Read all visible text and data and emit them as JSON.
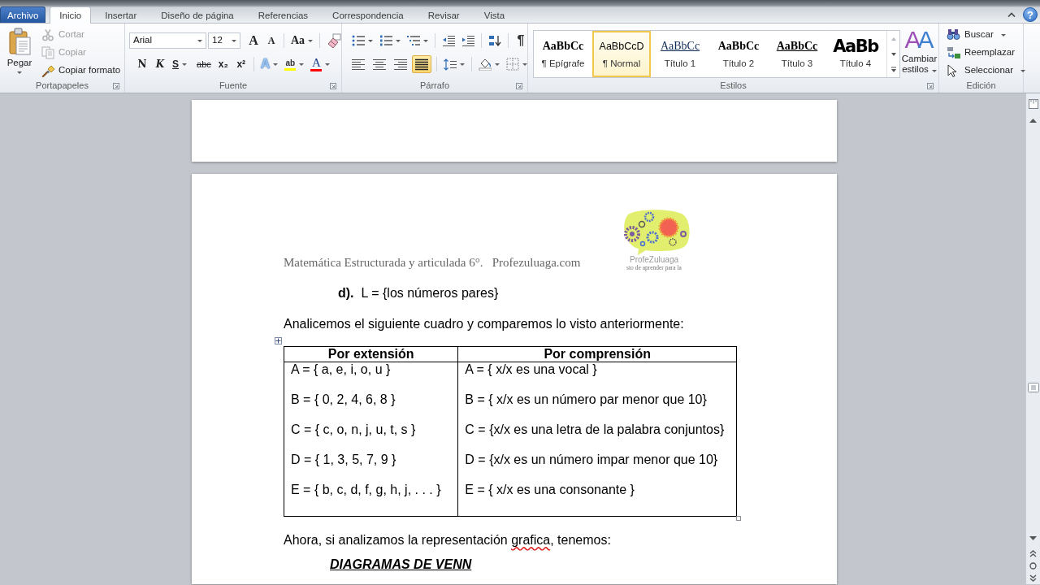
{
  "ribbon_tabs": [
    {
      "label": "Archivo",
      "kind": "file",
      "selected": false
    },
    {
      "label": "Inicio",
      "kind": "tab",
      "selected": true
    },
    {
      "label": "Insertar",
      "kind": "tab",
      "selected": false
    },
    {
      "label": "Diseño de página",
      "kind": "tab",
      "selected": false
    },
    {
      "label": "Referencias",
      "kind": "tab",
      "selected": false
    },
    {
      "label": "Correspondencia",
      "kind": "tab",
      "selected": false
    },
    {
      "label": "Revisar",
      "kind": "tab",
      "selected": false
    },
    {
      "label": "Vista",
      "kind": "tab",
      "selected": false
    }
  ],
  "help_button": "?",
  "clipboard": {
    "title": "Portapapeles",
    "paste": "Pegar",
    "items": [
      {
        "label": "Cortar",
        "kind": "cut",
        "disabled": true
      },
      {
        "label": "Copiar",
        "kind": "copy",
        "disabled": true
      },
      {
        "label": "Copiar formato",
        "kind": "format_painter",
        "disabled": false
      }
    ]
  },
  "font": {
    "title": "Fuente",
    "name": "Arial",
    "size": "12",
    "grow": "A",
    "shrink": "A",
    "change_case": "Aa",
    "format_buttons": [
      {
        "label": "N",
        "kind": "bold"
      },
      {
        "label": "K",
        "kind": "italic"
      },
      {
        "label": "S",
        "kind": "underline"
      },
      {
        "label": "abc",
        "kind": "strikethrough"
      },
      {
        "label": "x₂",
        "kind": "subscript"
      },
      {
        "label": "x²",
        "kind": "superscript"
      }
    ],
    "text_effects": "A",
    "highlight": {
      "label": "ab",
      "color": "#ffff00"
    },
    "font_color": {
      "label": "A",
      "color": "#ff0000"
    }
  },
  "paragraph": {
    "title": "Párrafo",
    "show_marks": "¶",
    "alignment": [
      {
        "kind": "left",
        "selected": false
      },
      {
        "kind": "center",
        "selected": false
      },
      {
        "kind": "right",
        "selected": false
      },
      {
        "kind": "justify",
        "selected": true
      }
    ]
  },
  "styles": {
    "title": "Estilos",
    "items": [
      {
        "preview": "AaBbCc",
        "label": "¶ Epígrafe",
        "kind": "epigraph",
        "selected": false
      },
      {
        "preview": "AaBbCcD",
        "label": "¶ Normal",
        "kind": "normal",
        "selected": true
      },
      {
        "preview": "AaBbCc",
        "label": "Título 1",
        "kind": "heading1",
        "selected": false
      },
      {
        "preview": "AaBbCc",
        "label": "Título 2",
        "kind": "heading2",
        "selected": false
      },
      {
        "preview": "AaBbCc",
        "label": "Título 3",
        "kind": "heading3",
        "selected": false
      },
      {
        "preview": "AaBb",
        "label": "Título 4",
        "kind": "heading4",
        "selected": false
      }
    ],
    "change_styles": {
      "icon_text": "AA",
      "label": "Cambiar estilos"
    }
  },
  "editing": {
    "title": "Edición",
    "items": [
      {
        "label": "Buscar",
        "kind": "find",
        "dropdown": true
      },
      {
        "label": "Reemplazar",
        "kind": "replace",
        "dropdown": false
      },
      {
        "label": "Seleccionar",
        "kind": "select",
        "dropdown": true
      }
    ]
  },
  "document": {
    "header_text": "Matemática Estructurada y articulada 6°.   Profezuluaga.com",
    "logo_text": [
      "ProfeZuluaga",
      "sto de aprender para la"
    ],
    "item": "**d).**  L = {los números pares}",
    "intro": "Analicemos el siguiente cuadro y comparemos lo visto anteriormente:",
    "table": {
      "columns": [
        "Por extensión",
        "Por comprensión"
      ],
      "rows": [
        [
          "A = { a, e, i, o, u }",
          "A = { x/x es una vocal }"
        ],
        [
          "B = { 0, 2, 4, 6, 8 }",
          "B = { x/x es un número par menor que 10}"
        ],
        [
          "C = { c, o, n, j, u, t, s }",
          "C = {x/x es una letra de la palabra conjuntos}"
        ],
        [
          "D = { 1, 3, 5, 7, 9 }",
          "D = {x/x es un número impar menor que 10}"
        ],
        [
          "E = { b, c, d, f, g, h, j, . . . }",
          "E = { x/x es una consonante }"
        ]
      ]
    },
    "after": [
      {
        "text": "Ahora, si analizamos la representación ",
        "misspelled": false
      },
      {
        "text": "grafica",
        "misspelled": true
      },
      {
        "text": ", tenemos:",
        "misspelled": false
      }
    ],
    "heading": "DIAGRAMAS DE VENN"
  }
}
